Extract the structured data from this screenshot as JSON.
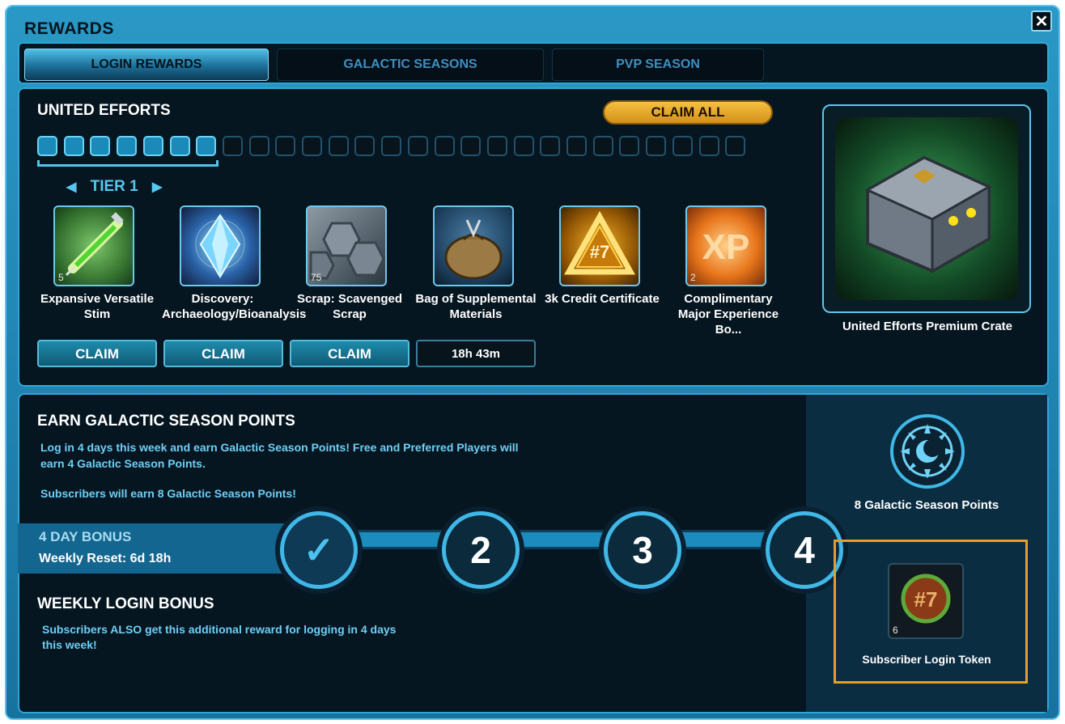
{
  "window": {
    "title": "REWARDS",
    "close_label": "✕"
  },
  "tabs": [
    {
      "label": "LOGIN REWARDS",
      "active": true
    },
    {
      "label": "GALACTIC SEASONS",
      "active": false
    },
    {
      "label": "PVP SEASON",
      "active": false
    }
  ],
  "united_efforts": {
    "heading": "UNITED EFFORTS",
    "claim_all_label": "CLAIM ALL",
    "progress": {
      "claimed": 7,
      "total": 27
    },
    "tier_label": "TIER 1",
    "rewards": [
      {
        "name": "Expansive Versatile Stim",
        "qty": "5",
        "action": "CLAIM",
        "icon": "stim-syringe-icon"
      },
      {
        "name": "Discovery: Archaeology/Bioanalysis",
        "qty": "",
        "action": "CLAIM",
        "icon": "crystal-icon"
      },
      {
        "name": "Scrap: Scavenged Scrap",
        "qty": "75",
        "action": "CLAIM",
        "icon": "scrap-plates-icon"
      },
      {
        "name": "Bag of Supplemental Materials",
        "qty": "",
        "action": "18h 43m",
        "icon": "material-bag-icon"
      },
      {
        "name": "3k Credit Certificate",
        "qty": "",
        "action": "",
        "icon": "credit-certificate-icon"
      },
      {
        "name": "Complimentary Major Experience Bo...",
        "qty": "2",
        "action": "",
        "icon": "xp-boost-icon"
      }
    ],
    "grand_reward": {
      "name": "United Efforts Premium Crate",
      "icon": "premium-crate-icon"
    }
  },
  "galactic_points": {
    "heading": "EARN GALACTIC SEASON POINTS",
    "line1": "Log in 4 days this week and earn Galactic Season Points!  Free and Preferred Players will",
    "line2": "earn 4 Galactic Season Points.",
    "line3": "Subscribers will earn 8 Galactic Season Points!",
    "reward_label": "8 Galactic Season Points",
    "reward_icon": "galactic-season-emblem-icon"
  },
  "day_bonus": {
    "heading": "4 DAY BONUS",
    "reset": "Weekly Reset: 6d 18h",
    "steps": [
      "✓",
      "2",
      "3",
      "4"
    ],
    "completed": 1
  },
  "weekly_login": {
    "heading": "WEEKLY LOGIN BONUS",
    "line1": "Subscribers ALSO get this additional reward for logging in 4 days",
    "line2": "this week!",
    "reward_label": "Subscriber Login Token",
    "reward_qty": "6",
    "reward_icon": "login-token-icon"
  },
  "colors": {
    "accent": "#2ea7d7",
    "gold": "#e2a02a",
    "panel": "#061621",
    "text_blue": "#6ecff5"
  }
}
